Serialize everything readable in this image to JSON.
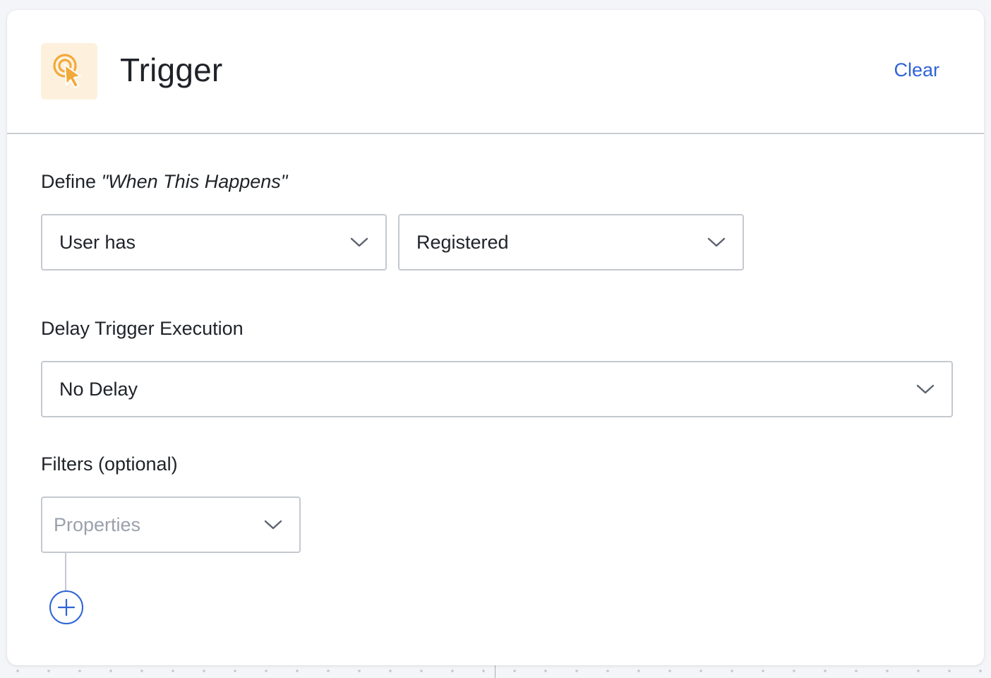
{
  "header": {
    "title": "Trigger",
    "clear_label": "Clear",
    "icon": "pointer-click-icon",
    "icon_color": "#f2a93b",
    "icon_bg": "#fdf1de"
  },
  "trigger_section": {
    "label_prefix": "Define ",
    "label_emphasis": "\"When This Happens\"",
    "subject_select": {
      "value": "User has",
      "icon": "chevron-down-icon"
    },
    "event_select": {
      "value": "Registered",
      "icon": "chevron-down-icon"
    }
  },
  "delay_section": {
    "label": "Delay Trigger Execution",
    "select": {
      "value": "No Delay",
      "icon": "chevron-down-icon"
    }
  },
  "filters_section": {
    "label": "Filters (optional)",
    "properties_select": {
      "placeholder": "Properties",
      "icon": "chevron-down-icon"
    },
    "add_button": {
      "icon": "plus-circle-icon"
    }
  },
  "colors": {
    "accent": "#2f64d6",
    "border": "#c4c8cf",
    "placeholder": "#9aa1ab"
  }
}
